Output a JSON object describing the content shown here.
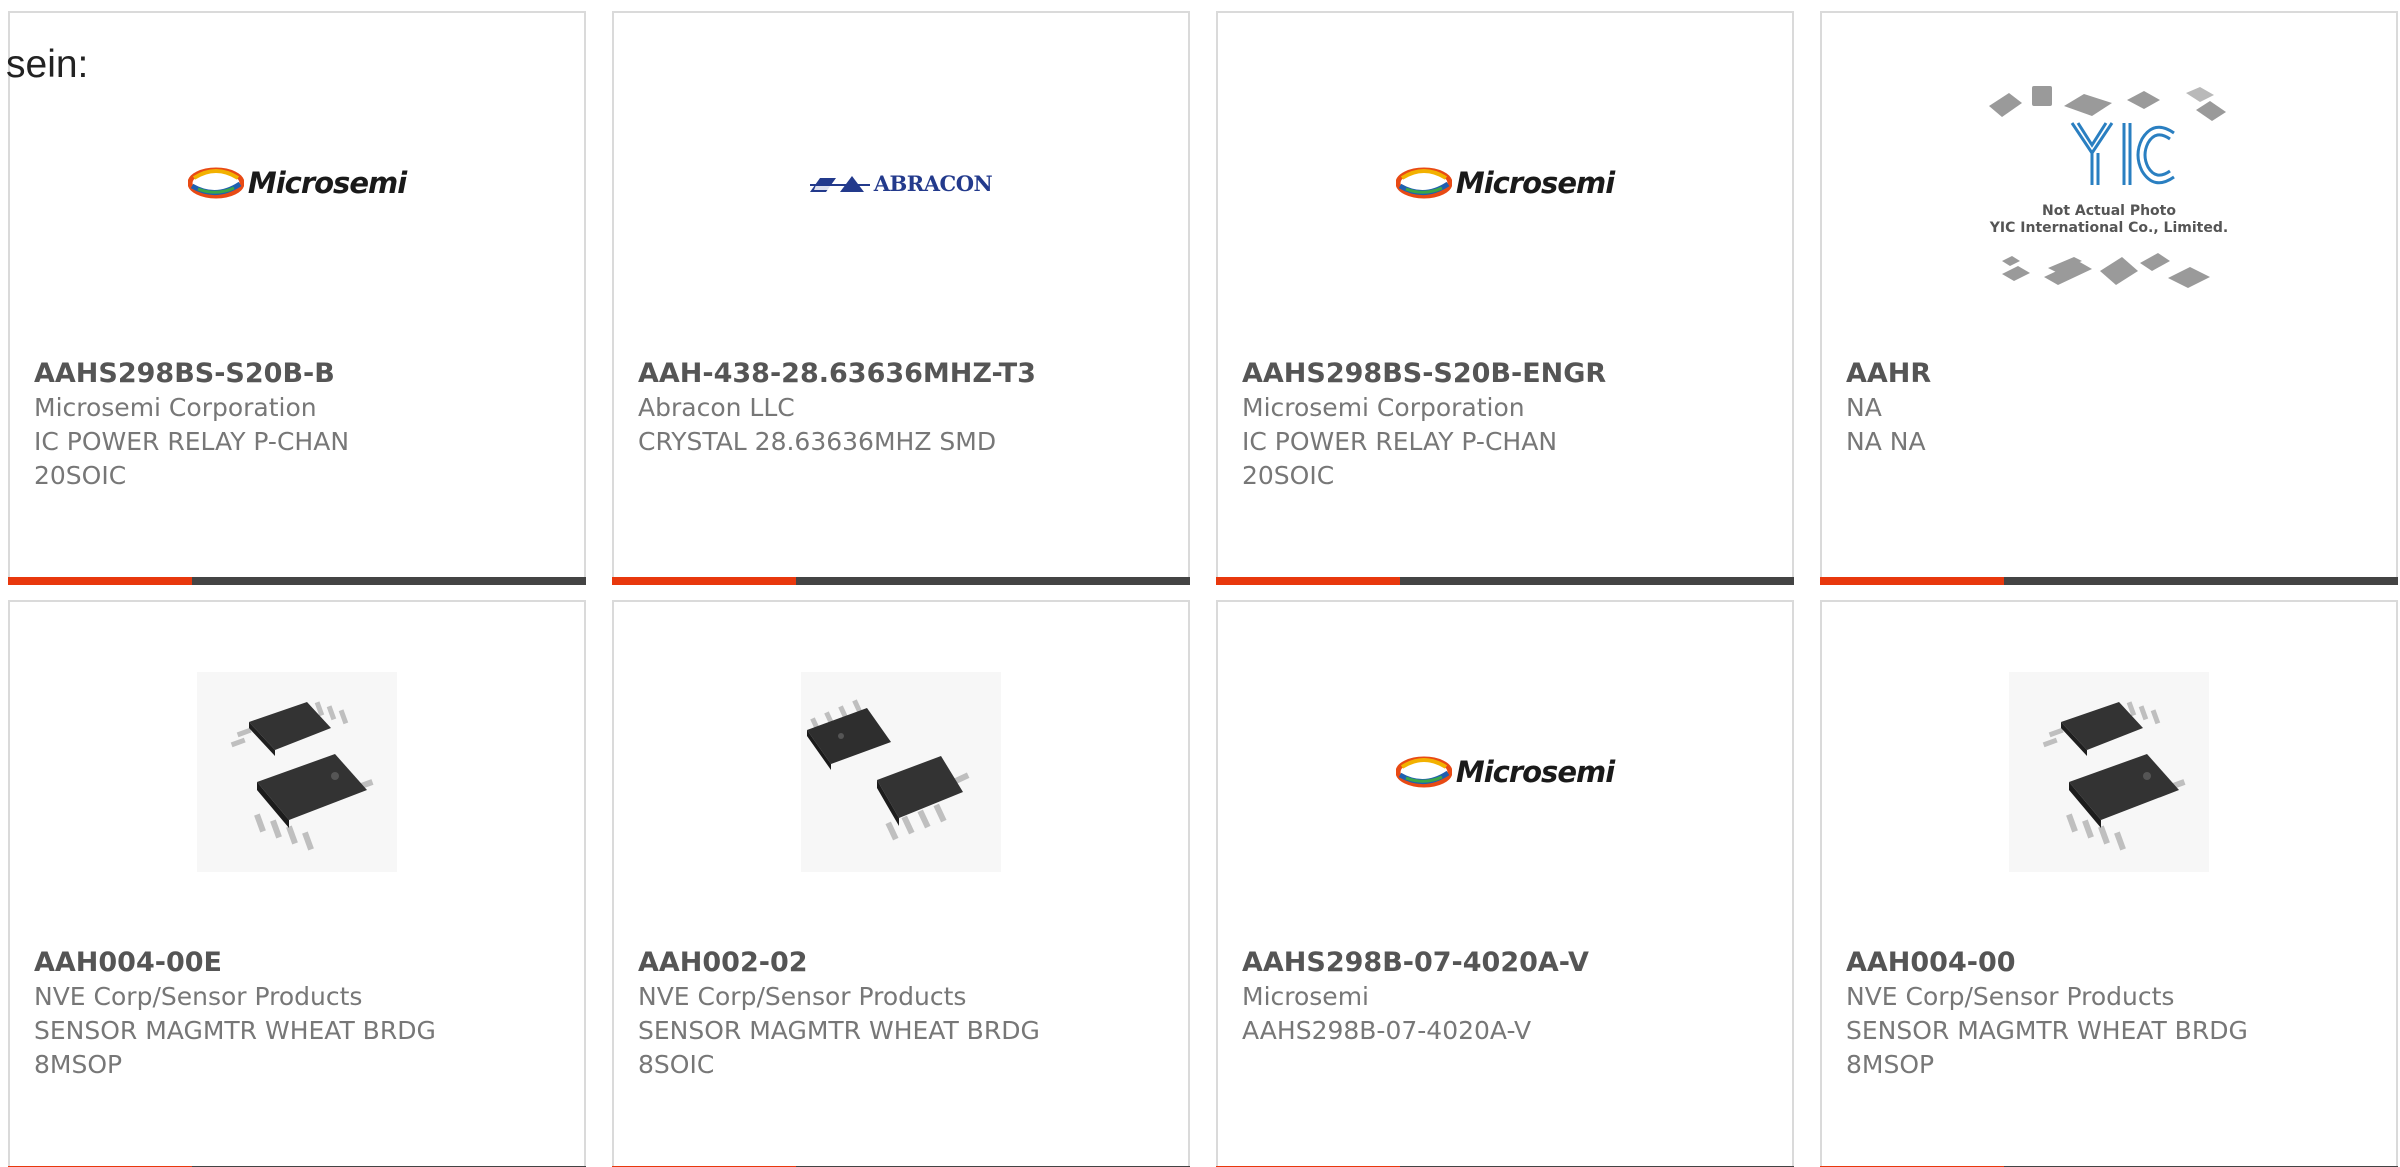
{
  "intro_text": "sein:",
  "products": [
    {
      "part": "AAHS298BS-S20B-B",
      "lines": [
        "Microsemi Corporation",
        "IC POWER RELAY P-CHAN",
        "20SOIC"
      ],
      "image": "microsemi-logo",
      "logo_text": "Microsemi"
    },
    {
      "part": "AAH-438-28.63636MHZ-T3",
      "lines": [
        "Abracon LLC",
        "CRYSTAL 28.63636MHZ SMD"
      ],
      "image": "abracon-logo",
      "logo_text": "ABRACON"
    },
    {
      "part": "AAHS298BS-S20B-ENGR",
      "lines": [
        "Microsemi Corporation",
        "IC POWER RELAY P-CHAN",
        "20SOIC"
      ],
      "image": "microsemi-logo",
      "logo_text": "Microsemi"
    },
    {
      "part": "AAHR",
      "lines": [
        "NA",
        "NA NA"
      ],
      "image": "yic-placeholder",
      "logo_text": "YIC",
      "caption_lines": [
        "Not Actual Photo",
        "YIC International Co., Limited."
      ]
    },
    {
      "part": "AAH004-00E",
      "lines": [
        "NVE Corp/Sensor Products",
        "SENSOR MAGMTR WHEAT BRDG",
        "8MSOP"
      ],
      "image": "msop-chip-photo"
    },
    {
      "part": "AAH002-02",
      "lines": [
        "NVE Corp/Sensor Products",
        "SENSOR MAGMTR WHEAT BRDG",
        "8SOIC"
      ],
      "image": "soic-chip-photo"
    },
    {
      "part": "AAHS298B-07-4020A-V",
      "lines": [
        "Microsemi",
        "AAHS298B-07-4020A-V"
      ],
      "image": "microsemi-logo",
      "logo_text": "Microsemi"
    },
    {
      "part": "AAH004-00",
      "lines": [
        "NVE Corp/Sensor Products",
        "SENSOR MAGMTR WHEAT BRDG",
        "8MSOP"
      ],
      "image": "msop-chip-photo"
    }
  ],
  "colors": {
    "accent": "#e8380d",
    "bar": "#444444",
    "border": "#dadada",
    "title": "#555555",
    "text": "#777777",
    "microsemi_blue": "#1f5fb0",
    "abracon_blue": "#233a8c",
    "yic_blue": "#2a7fc1"
  }
}
